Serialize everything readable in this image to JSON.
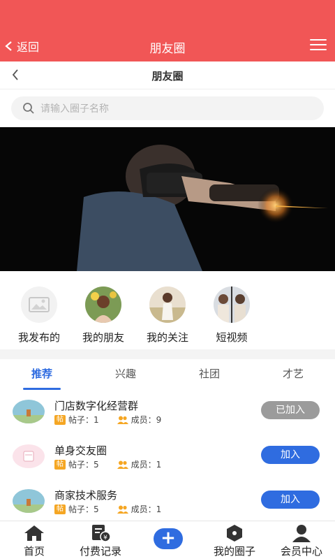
{
  "topbar": {
    "back_label": "返回",
    "title": "朋友圈",
    "color": "#f15656"
  },
  "subbar": {
    "title": "朋友圈"
  },
  "search": {
    "placeholder": "请输入圈子名称"
  },
  "quick": [
    {
      "label": "我发布的",
      "icon": "image-placeholder-icon"
    },
    {
      "label": "我的朋友",
      "icon": "friends-avatar"
    },
    {
      "label": "我的关注",
      "icon": "following-avatar"
    },
    {
      "label": "短视频",
      "icon": "short-video-avatar"
    }
  ],
  "tabs": [
    {
      "label": "推荐",
      "active": true
    },
    {
      "label": "兴趣",
      "active": false
    },
    {
      "label": "社团",
      "active": false
    },
    {
      "label": "才艺",
      "active": false
    }
  ],
  "groups": [
    {
      "name": "门店数字化经营群",
      "posts_label": "帖子：",
      "posts": "1",
      "members_label": "成员：",
      "members": "9",
      "button": "已加入",
      "joined": true
    },
    {
      "name": "单身交友圈",
      "posts_label": "帖子：",
      "posts": "5",
      "members_label": "成员：",
      "members": "1",
      "button": "加入",
      "joined": false
    },
    {
      "name": "商家技术服务",
      "posts_label": "帖子：",
      "posts": "5",
      "members_label": "成员：",
      "members": "1",
      "button": "加入",
      "joined": false
    }
  ],
  "badge_text": "帖",
  "bottomnav": {
    "home": "首页",
    "payments": "付费记录",
    "my_circles": "我的圈子",
    "member_center": "会员中心",
    "plus": "+"
  },
  "colors": {
    "accent": "#2f6ce0",
    "joined_gray": "#9b9b9b",
    "badge": "#f5a623"
  }
}
